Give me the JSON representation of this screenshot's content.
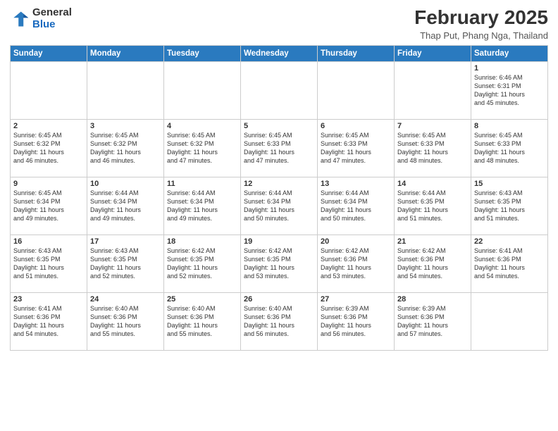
{
  "logo": {
    "general": "General",
    "blue": "Blue"
  },
  "title": "February 2025",
  "location": "Thap Put, Phang Nga, Thailand",
  "days_of_week": [
    "Sunday",
    "Monday",
    "Tuesday",
    "Wednesday",
    "Thursday",
    "Friday",
    "Saturday"
  ],
  "weeks": [
    [
      {
        "day": "",
        "info": ""
      },
      {
        "day": "",
        "info": ""
      },
      {
        "day": "",
        "info": ""
      },
      {
        "day": "",
        "info": ""
      },
      {
        "day": "",
        "info": ""
      },
      {
        "day": "",
        "info": ""
      },
      {
        "day": "1",
        "info": "Sunrise: 6:46 AM\nSunset: 6:31 PM\nDaylight: 11 hours\nand 45 minutes."
      }
    ],
    [
      {
        "day": "2",
        "info": "Sunrise: 6:45 AM\nSunset: 6:32 PM\nDaylight: 11 hours\nand 46 minutes."
      },
      {
        "day": "3",
        "info": "Sunrise: 6:45 AM\nSunset: 6:32 PM\nDaylight: 11 hours\nand 46 minutes."
      },
      {
        "day": "4",
        "info": "Sunrise: 6:45 AM\nSunset: 6:32 PM\nDaylight: 11 hours\nand 47 minutes."
      },
      {
        "day": "5",
        "info": "Sunrise: 6:45 AM\nSunset: 6:33 PM\nDaylight: 11 hours\nand 47 minutes."
      },
      {
        "day": "6",
        "info": "Sunrise: 6:45 AM\nSunset: 6:33 PM\nDaylight: 11 hours\nand 47 minutes."
      },
      {
        "day": "7",
        "info": "Sunrise: 6:45 AM\nSunset: 6:33 PM\nDaylight: 11 hours\nand 48 minutes."
      },
      {
        "day": "8",
        "info": "Sunrise: 6:45 AM\nSunset: 6:33 PM\nDaylight: 11 hours\nand 48 minutes."
      }
    ],
    [
      {
        "day": "9",
        "info": "Sunrise: 6:45 AM\nSunset: 6:34 PM\nDaylight: 11 hours\nand 49 minutes."
      },
      {
        "day": "10",
        "info": "Sunrise: 6:44 AM\nSunset: 6:34 PM\nDaylight: 11 hours\nand 49 minutes."
      },
      {
        "day": "11",
        "info": "Sunrise: 6:44 AM\nSunset: 6:34 PM\nDaylight: 11 hours\nand 49 minutes."
      },
      {
        "day": "12",
        "info": "Sunrise: 6:44 AM\nSunset: 6:34 PM\nDaylight: 11 hours\nand 50 minutes."
      },
      {
        "day": "13",
        "info": "Sunrise: 6:44 AM\nSunset: 6:34 PM\nDaylight: 11 hours\nand 50 minutes."
      },
      {
        "day": "14",
        "info": "Sunrise: 6:44 AM\nSunset: 6:35 PM\nDaylight: 11 hours\nand 51 minutes."
      },
      {
        "day": "15",
        "info": "Sunrise: 6:43 AM\nSunset: 6:35 PM\nDaylight: 11 hours\nand 51 minutes."
      }
    ],
    [
      {
        "day": "16",
        "info": "Sunrise: 6:43 AM\nSunset: 6:35 PM\nDaylight: 11 hours\nand 51 minutes."
      },
      {
        "day": "17",
        "info": "Sunrise: 6:43 AM\nSunset: 6:35 PM\nDaylight: 11 hours\nand 52 minutes."
      },
      {
        "day": "18",
        "info": "Sunrise: 6:42 AM\nSunset: 6:35 PM\nDaylight: 11 hours\nand 52 minutes."
      },
      {
        "day": "19",
        "info": "Sunrise: 6:42 AM\nSunset: 6:35 PM\nDaylight: 11 hours\nand 53 minutes."
      },
      {
        "day": "20",
        "info": "Sunrise: 6:42 AM\nSunset: 6:36 PM\nDaylight: 11 hours\nand 53 minutes."
      },
      {
        "day": "21",
        "info": "Sunrise: 6:42 AM\nSunset: 6:36 PM\nDaylight: 11 hours\nand 54 minutes."
      },
      {
        "day": "22",
        "info": "Sunrise: 6:41 AM\nSunset: 6:36 PM\nDaylight: 11 hours\nand 54 minutes."
      }
    ],
    [
      {
        "day": "23",
        "info": "Sunrise: 6:41 AM\nSunset: 6:36 PM\nDaylight: 11 hours\nand 54 minutes."
      },
      {
        "day": "24",
        "info": "Sunrise: 6:40 AM\nSunset: 6:36 PM\nDaylight: 11 hours\nand 55 minutes."
      },
      {
        "day": "25",
        "info": "Sunrise: 6:40 AM\nSunset: 6:36 PM\nDaylight: 11 hours\nand 55 minutes."
      },
      {
        "day": "26",
        "info": "Sunrise: 6:40 AM\nSunset: 6:36 PM\nDaylight: 11 hours\nand 56 minutes."
      },
      {
        "day": "27",
        "info": "Sunrise: 6:39 AM\nSunset: 6:36 PM\nDaylight: 11 hours\nand 56 minutes."
      },
      {
        "day": "28",
        "info": "Sunrise: 6:39 AM\nSunset: 6:36 PM\nDaylight: 11 hours\nand 57 minutes."
      },
      {
        "day": "",
        "info": ""
      }
    ]
  ]
}
